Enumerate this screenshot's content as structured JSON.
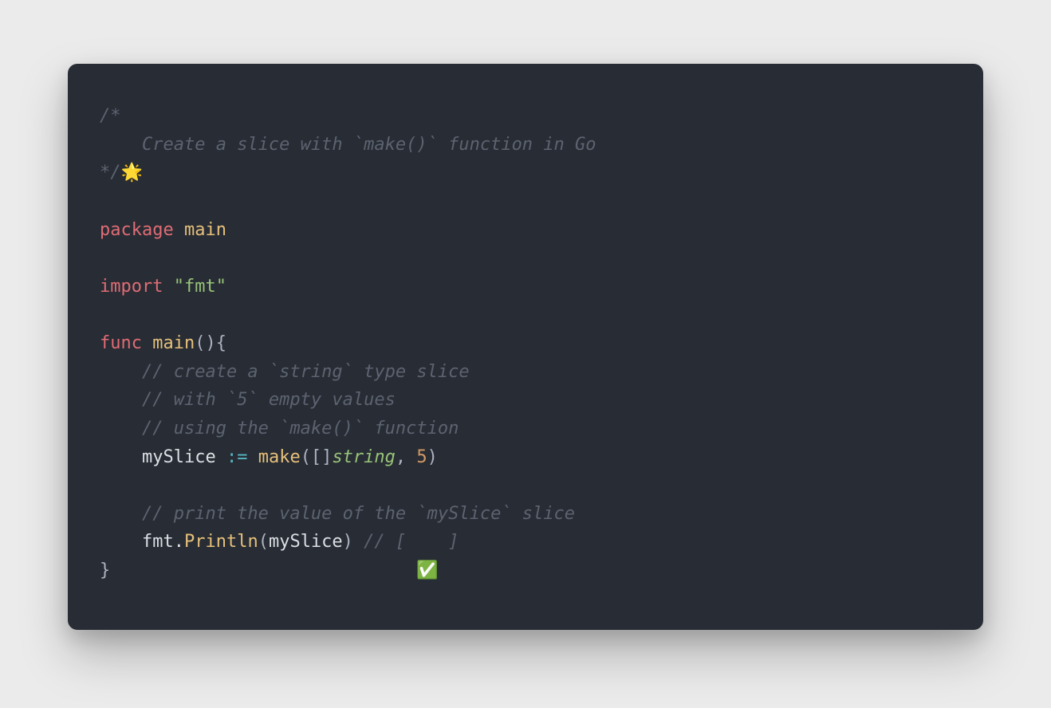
{
  "code": {
    "line1": "/*",
    "line2_indent": "    ",
    "line2_text": "Create a slice with `make()` function in Go",
    "line3_text": "*/",
    "line3_emoji": "🌟",
    "blank1": "",
    "line5_keyword": "package",
    "line5_space": " ",
    "line5_name": "main",
    "blank2": "",
    "line7_keyword": "import",
    "line7_space": " ",
    "line7_string": "\"fmt\"",
    "blank3": "",
    "line9_func": "func",
    "line9_space": " ",
    "line9_name": "main",
    "line9_parens": "(){",
    "line10_indent": "    ",
    "line10_comment": "// create a `string` type slice",
    "line11_indent": "    ",
    "line11_comment": "// with `5` empty values",
    "line12_indent": "    ",
    "line12_comment": "// using the `make()` function",
    "line13_indent": "    ",
    "line13_var": "mySlice",
    "line13_sp1": " ",
    "line13_op": ":=",
    "line13_sp2": " ",
    "line13_make": "make",
    "line13_paren_open": "([]",
    "line13_type": "string",
    "line13_comma": ", ",
    "line13_num": "5",
    "line13_paren_close": ")",
    "blank4": "",
    "line15_indent": "    ",
    "line15_comment": "// print the value of the `mySlice` slice",
    "line16_indent": "    ",
    "line16_fmt": "fmt",
    "line16_dot": ".",
    "line16_println": "Println",
    "line16_open": "(",
    "line16_arg": "mySlice",
    "line16_close": ")",
    "line16_sp": " ",
    "line16_comment": "// [    ]",
    "line17_brace": "}",
    "line17_pad": "                             ",
    "line17_emoji": "✅"
  }
}
